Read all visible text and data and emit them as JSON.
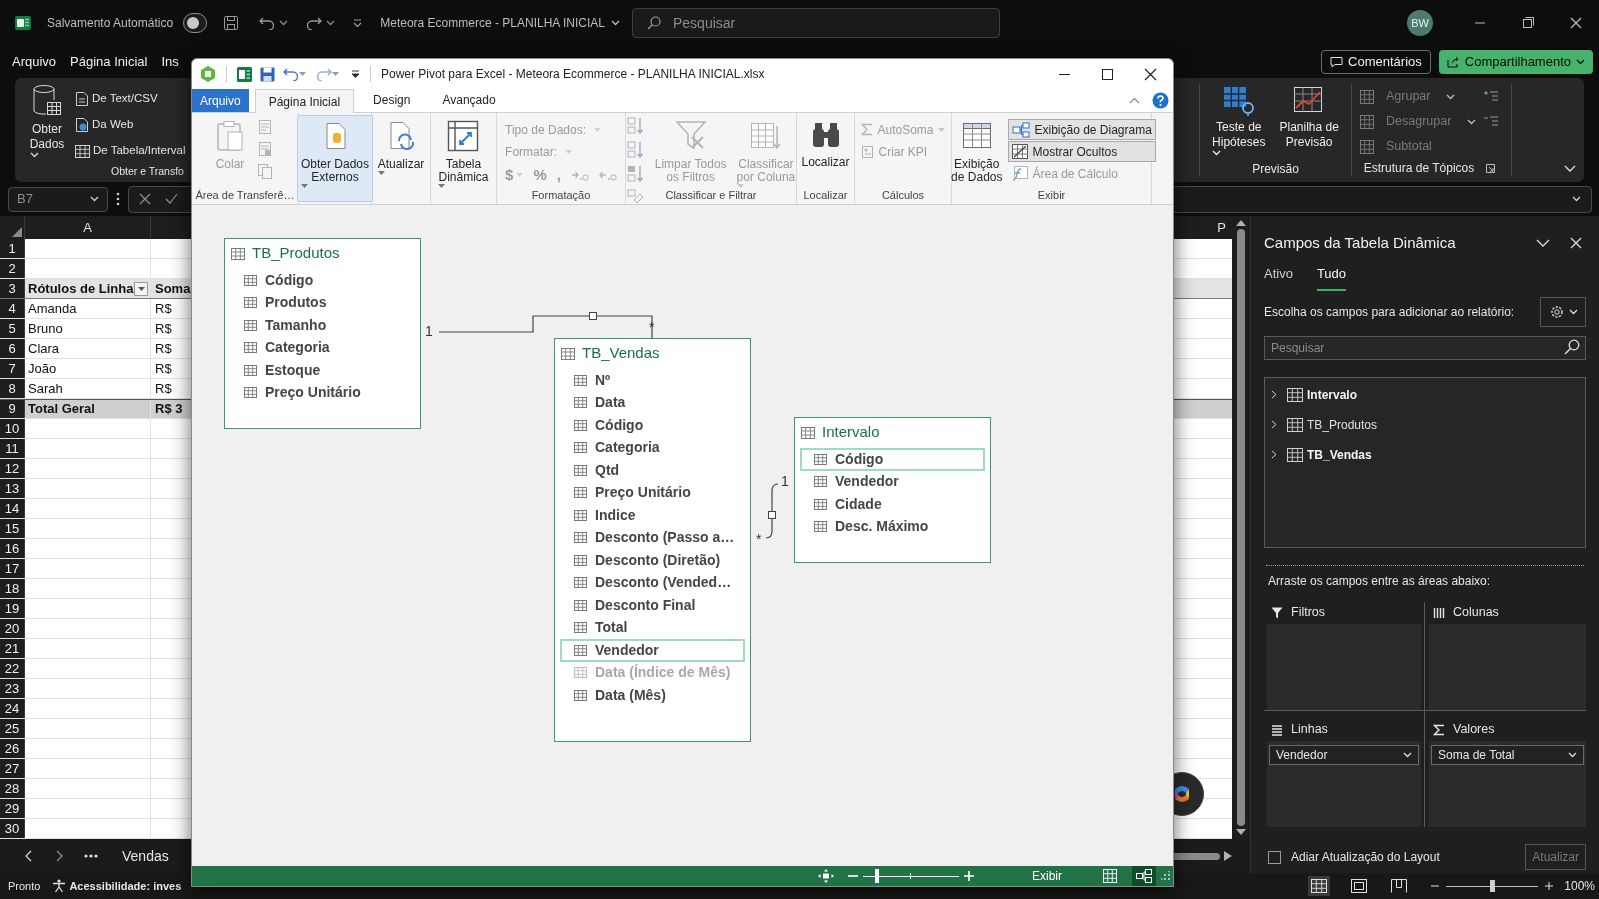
{
  "excel": {
    "title_bar": {
      "autosave_label": "Salvamento Automático",
      "autosave_on": false,
      "document_title": "Meteora Ecommerce - PLANILHA INICIAL",
      "search_placeholder": "Pesquisar",
      "user_initials": "BW"
    },
    "menu": [
      "Arquivo",
      "Página Inicial",
      "Ins"
    ],
    "comments_button": "Comentários",
    "share_button": "Compartilhamento",
    "ribbon_left": {
      "large_button": {
        "lines": [
          "Obter",
          "Dados"
        ],
        "dropdown": true
      },
      "items": [
        "De Text/CSV",
        "Da Web",
        "De Tabela/Interval"
      ],
      "group_label": "Obter e Transfo"
    },
    "forecast_group": {
      "label": "Previsão",
      "buttons": [
        {
          "lines": [
            "Teste de",
            "Hipóteses"
          ],
          "dropdown": true
        },
        {
          "lines": [
            "Planilha de",
            "Previsão"
          ],
          "dropdown": false
        }
      ]
    },
    "outline_group": {
      "label": "Estrutura de Tópicos",
      "items": [
        {
          "label": "Agrupar",
          "dropdown": true,
          "disabled": true
        },
        {
          "label": "Desagrupar",
          "dropdown": true,
          "disabled": true
        },
        {
          "label": "Subtotal",
          "dropdown": false,
          "disabled": true
        }
      ]
    },
    "name_box": "B7",
    "column_headers": [
      "A",
      "P"
    ],
    "rows": [
      {
        "number": "1",
        "kind": "empty"
      },
      {
        "number": "2",
        "kind": "empty"
      },
      {
        "number": "3",
        "kind": "header",
        "cells": [
          "Rótulos de Linha",
          "Soma"
        ]
      },
      {
        "number": "4",
        "kind": "data",
        "cells": [
          "Amanda",
          "R$"
        ]
      },
      {
        "number": "5",
        "kind": "data",
        "cells": [
          "Bruno",
          "R$"
        ]
      },
      {
        "number": "6",
        "kind": "data",
        "cells": [
          "Clara",
          "R$"
        ]
      },
      {
        "number": "7",
        "kind": "data",
        "cells": [
          "João",
          "R$"
        ]
      },
      {
        "number": "8",
        "kind": "data",
        "cells": [
          "Sarah",
          "R$"
        ]
      },
      {
        "number": "9",
        "kind": "total",
        "cells": [
          "Total Geral",
          "R$ 3"
        ]
      },
      {
        "number": "10",
        "kind": "empty"
      },
      {
        "number": "11",
        "kind": "empty"
      },
      {
        "number": "12",
        "kind": "empty"
      },
      {
        "number": "13",
        "kind": "empty"
      },
      {
        "number": "14",
        "kind": "empty"
      },
      {
        "number": "15",
        "kind": "empty"
      },
      {
        "number": "16",
        "kind": "empty"
      },
      {
        "number": "17",
        "kind": "empty"
      },
      {
        "number": "18",
        "kind": "empty"
      },
      {
        "number": "19",
        "kind": "empty"
      },
      {
        "number": "20",
        "kind": "empty"
      },
      {
        "number": "21",
        "kind": "empty"
      },
      {
        "number": "22",
        "kind": "empty"
      },
      {
        "number": "23",
        "kind": "empty"
      },
      {
        "number": "24",
        "kind": "empty"
      },
      {
        "number": "25",
        "kind": "empty"
      },
      {
        "number": "26",
        "kind": "empty"
      },
      {
        "number": "27",
        "kind": "empty"
      },
      {
        "number": "28",
        "kind": "empty"
      },
      {
        "number": "29",
        "kind": "empty"
      },
      {
        "number": "30",
        "kind": "empty"
      }
    ],
    "sheet_tab": "Vendas",
    "status_bar": {
      "ready": "Pronto",
      "accessibility": "Acessibilidade: inves",
      "views": [
        {
          "kind": "normal",
          "selected": true
        },
        {
          "kind": "page_layout",
          "selected": false
        },
        {
          "kind": "page_break",
          "selected": false
        }
      ],
      "zoom_slider": {
        "level": 0.5
      },
      "zoom": "100%"
    }
  },
  "pivot_fields": {
    "title": "Campos da Tabela Dinâmica",
    "tabs": [
      {
        "label": "Ativo",
        "selected": false
      },
      {
        "label": "Tudo",
        "selected": true
      }
    ],
    "prompt": "Escolha os campos para adicionar ao relatório:",
    "search_placeholder": "Pesquisar",
    "tables": [
      {
        "name": "Intervalo",
        "bold": true
      },
      {
        "name": "TB_Produtos",
        "bold": false
      },
      {
        "name": "TB_Vendas",
        "bold": true
      }
    ],
    "drag_hint": "Arraste os campos entre as áreas abaixo:",
    "areas": [
      {
        "kind": "filters",
        "label": "Filtros"
      },
      {
        "kind": "columns",
        "label": "Colunas"
      },
      {
        "kind": "rows",
        "label": "Linhas",
        "fields": [
          "Vendedor"
        ]
      },
      {
        "kind": "values",
        "label": "Valores",
        "fields": [
          "Soma de Total"
        ]
      }
    ],
    "defer_label": "Adiar Atualização do Layout",
    "defer_checked": false,
    "update_button": "Atualizar",
    "update_disabled": true
  },
  "power_pivot": {
    "title": "Power Pivot para Excel - Meteora Ecommerce - PLANILHA INICIAL.xlsx",
    "tabs": [
      {
        "label": "Arquivo",
        "kind": "file",
        "selected": false
      },
      {
        "label": "Página Inicial",
        "kind": "tab",
        "selected": true
      },
      {
        "label": "Design",
        "kind": "tab",
        "selected": false
      },
      {
        "label": "Avançado",
        "kind": "tab",
        "selected": false
      }
    ],
    "ribbon": [
      {
        "label": "Área de Transferê…",
        "items": [
          {
            "kind": "large",
            "lines": [
              "Colar"
            ],
            "dropdown": false,
            "disabled": true
          },
          {
            "kind": "icon_stack",
            "disabled": true
          }
        ]
      },
      {
        "items": [
          {
            "kind": "large",
            "lines": [
              "Obter Dados",
              "Externos"
            ],
            "dropdown": true,
            "disabled": false,
            "active": true
          }
        ]
      },
      {
        "items": [
          {
            "kind": "large",
            "lines": [
              "Atualizar"
            ],
            "dropdown": true,
            "disabled": false
          }
        ]
      },
      {
        "items": [
          {
            "kind": "large",
            "lines": [
              "Tabela",
              "Dinâmica"
            ],
            "dropdown": true,
            "disabled": false
          }
        ]
      },
      {
        "label": "Formatação",
        "items": [
          {
            "kind": "combo",
            "label": "Tipo de Dados:",
            "disabled": true
          },
          {
            "kind": "combo",
            "label": "Formatar:",
            "disabled": true
          },
          {
            "kind": "format_buttons",
            "symbols": [
              "$",
              "%",
              ","
            ],
            "disabled": true
          }
        ]
      },
      {
        "label": "Classificar e Filtrar",
        "items": [
          {
            "kind": "sort_icons",
            "disabled": true
          },
          {
            "kind": "large",
            "lines": [
              "Limpar Todos",
              "os Filtros"
            ],
            "dropdown": false,
            "disabled": true
          },
          {
            "kind": "large",
            "lines": [
              "Classificar",
              "por Coluna"
            ],
            "dropdown": true,
            "disabled": true
          }
        ]
      },
      {
        "label": "Localizar",
        "items": [
          {
            "kind": "large",
            "lines": [
              "Localizar"
            ],
            "dropdown": false,
            "disabled": false
          }
        ]
      },
      {
        "label": "Cálculos",
        "items": [
          {
            "kind": "small",
            "label": "AutoSoma",
            "dropdown": true,
            "disabled": true,
            "selected": false
          },
          {
            "kind": "small",
            "label": "Criar KPI",
            "dropdown": false,
            "disabled": true,
            "selected": false
          }
        ]
      },
      {
        "label": "Exibir",
        "items": [
          {
            "kind": "large",
            "lines": [
              "Exibição",
              "de Dados"
            ],
            "dropdown": false,
            "disabled": false
          },
          {
            "kind": "small",
            "label": "Exibição de Diagrama",
            "dropdown": false,
            "disabled": false,
            "selected": true
          },
          {
            "kind": "small",
            "label": "Mostrar Ocultos",
            "dropdown": false,
            "disabled": false,
            "selected": true
          },
          {
            "kind": "small",
            "label": "Área de Cálculo",
            "dropdown": false,
            "disabled": true,
            "selected": false
          }
        ]
      }
    ],
    "tables": [
      {
        "name": "TB_Produtos",
        "fields": [
          {
            "name": "Código",
            "selected": false,
            "hidden": false
          },
          {
            "name": "Produtos",
            "selected": false,
            "hidden": false
          },
          {
            "name": "Tamanho",
            "selected": false,
            "hidden": false
          },
          {
            "name": "Categoria",
            "selected": false,
            "hidden": false
          },
          {
            "name": "Estoque",
            "selected": false,
            "hidden": false
          },
          {
            "name": "Preço Unitário",
            "selected": false,
            "hidden": false
          }
        ]
      },
      {
        "name": "TB_Vendas",
        "fields": [
          {
            "name": "Nº",
            "selected": false,
            "hidden": false
          },
          {
            "name": "Data",
            "selected": false,
            "hidden": false
          },
          {
            "name": "Código",
            "selected": false,
            "hidden": false
          },
          {
            "name": "Categoria",
            "selected": false,
            "hidden": false
          },
          {
            "name": "Qtd",
            "selected": false,
            "hidden": false
          },
          {
            "name": "Preço Unitário",
            "selected": false,
            "hidden": false
          },
          {
            "name": "Indice",
            "selected": false,
            "hidden": false
          },
          {
            "name": "Desconto (Passo a…",
            "selected": false,
            "hidden": false
          },
          {
            "name": "Desconto (Diretão)",
            "selected": false,
            "hidden": false
          },
          {
            "name": "Desconto (Vended…",
            "selected": false,
            "hidden": false
          },
          {
            "name": "Desconto Final",
            "selected": false,
            "hidden": false
          },
          {
            "name": "Total",
            "selected": false,
            "hidden": false
          },
          {
            "name": "Vendedor",
            "selected": true,
            "hidden": false
          },
          {
            "name": "Data (Índice de Mês)",
            "selected": false,
            "hidden": true
          },
          {
            "name": "Data (Mês)",
            "selected": false,
            "hidden": false
          }
        ]
      },
      {
        "name": "Intervalo",
        "fields": [
          {
            "name": "Código",
            "selected": true,
            "hidden": false
          },
          {
            "name": "Vendedor",
            "selected": false,
            "hidden": false
          },
          {
            "name": "Cidade",
            "selected": false,
            "hidden": false
          },
          {
            "name": "Desc. Máximo",
            "selected": false,
            "hidden": false
          }
        ]
      }
    ],
    "relationships": [
      {
        "from_label": "1",
        "to_label": "*"
      },
      {
        "from_label": "1",
        "to_label": "*"
      }
    ],
    "status_bar": {
      "zoom_slider": {
        "level": 0.15
      },
      "view_label": "Exibir",
      "views": [
        {
          "kind": "grid",
          "selected": false
        },
        {
          "kind": "diagram",
          "selected": true
        }
      ]
    }
  }
}
